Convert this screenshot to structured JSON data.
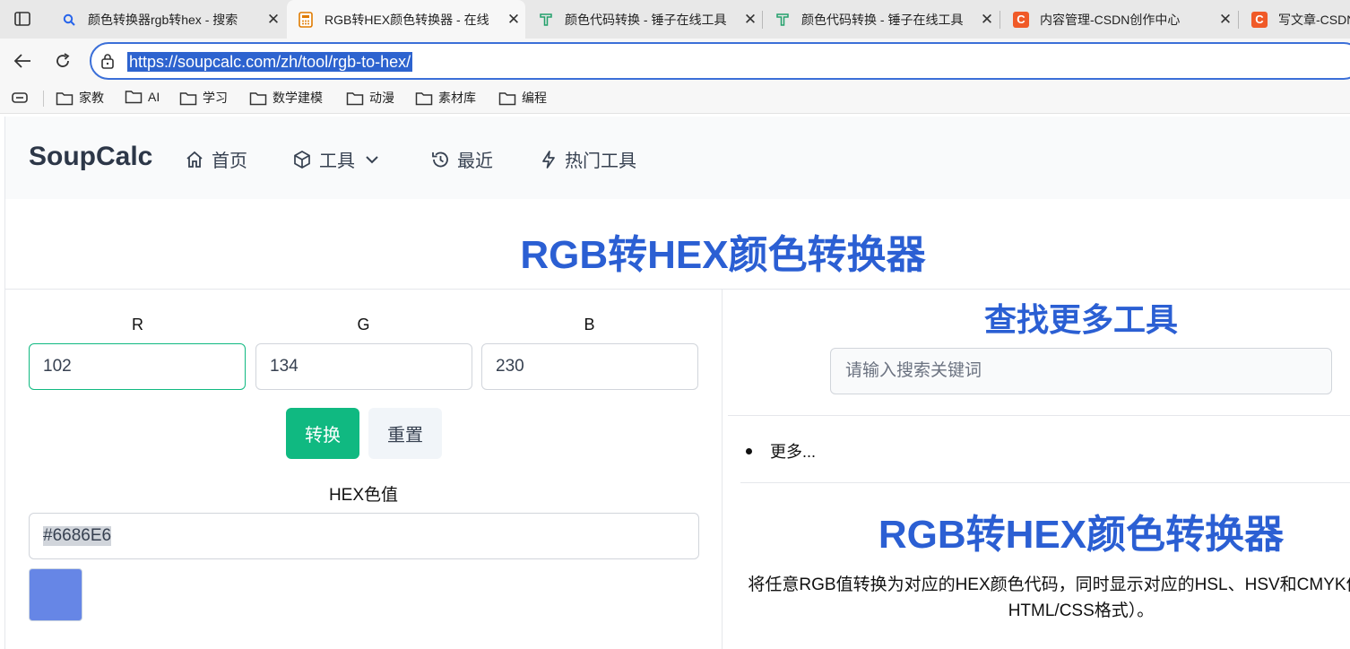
{
  "browser": {
    "tabs": [
      {
        "title": "颜色转换器rgb转hex - 搜索",
        "icon": "search-icon",
        "active": false
      },
      {
        "title": "RGB转HEX颜色转换器 - 在线",
        "icon": "calculator-icon",
        "active": true
      },
      {
        "title": "颜色代码转换 - 锤子在线工具",
        "icon": "hammer-icon",
        "active": false
      },
      {
        "title": "颜色代码转换 - 锤子在线工具",
        "icon": "hammer-icon",
        "active": false
      },
      {
        "title": "内容管理-CSDN创作中心",
        "icon": "csdn-icon",
        "active": false
      },
      {
        "title": "写文章-CSDN",
        "icon": "csdn-icon",
        "active": false
      }
    ],
    "url": "https://soupcalc.com/zh/tool/rgb-to-hex/",
    "bookmarks": [
      "家教",
      "AI",
      "学习",
      "数学建模",
      "动漫",
      "素材库",
      "编程"
    ]
  },
  "site": {
    "logo": "SoupCalc",
    "menu": [
      {
        "label": "首页",
        "icon": "home-icon"
      },
      {
        "label": "工具",
        "icon": "cube-icon"
      },
      {
        "label": "最近",
        "icon": "history-icon"
      },
      {
        "label": "热门工具",
        "icon": "bolt-icon"
      }
    ]
  },
  "converter": {
    "title": "RGB转HEX颜色转换器",
    "r_label": "R",
    "g_label": "G",
    "b_label": "B",
    "r_value": "102",
    "g_value": "134",
    "b_value": "230",
    "convert_label": "转换",
    "reset_label": "重置",
    "hex_label": "HEX色值",
    "hex_value": "#6686E6",
    "swatch_color": "#6686E6"
  },
  "sidebar": {
    "title": "查找更多工具",
    "search_placeholder": "请输入搜索关键词",
    "more_link": "更多...",
    "heading": "RGB转HEX颜色转换器",
    "description": "将任意RGB值转换为对应的HEX颜色代码，同时显示对应的HSL、HSV和CMYK值（包括HTML/CSS格式）。"
  }
}
